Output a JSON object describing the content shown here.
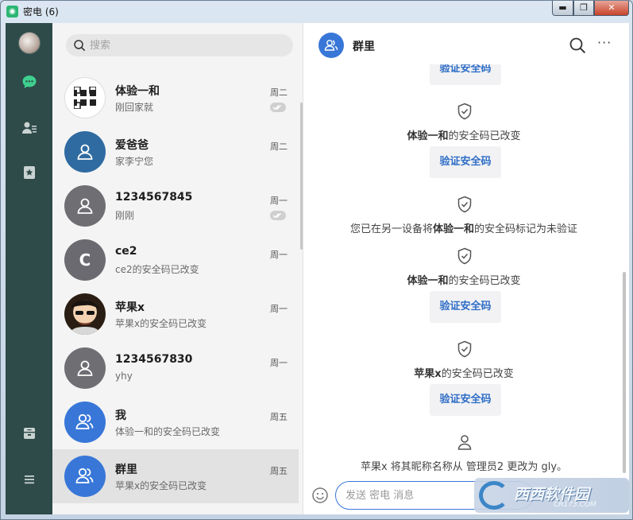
{
  "window": {
    "app_icon": "chat-bubble-icon",
    "title": "密电 (6)",
    "controls": {
      "minimize": "▬",
      "maximize": "❐",
      "close": "✕"
    }
  },
  "rail": {
    "items": [
      "user-avatar",
      "chat-icon",
      "contacts-icon",
      "favorites-icon",
      "archive-icon",
      "menu-icon"
    ]
  },
  "search": {
    "placeholder": "搜索"
  },
  "conversations": [
    {
      "name": "体验一和",
      "preview": "刚回家就",
      "time": "周二",
      "avatar": "qr-avatar",
      "read": true,
      "selected": false
    },
    {
      "name": "爱爸爸",
      "preview": "家李宁您",
      "time": "周二",
      "avatar": "person-dark-blue",
      "read": false,
      "selected": false
    },
    {
      "name": "1234567845",
      "preview": "刚刚",
      "time": "周一",
      "avatar": "person-gray",
      "read": true,
      "selected": false
    },
    {
      "name": "ce2",
      "preview": "ce2的安全码已改变",
      "time": "周一",
      "avatar": "letter-C",
      "initial": "C",
      "read": false,
      "selected": false
    },
    {
      "name": "苹果x",
      "preview": "苹果x的安全码已改变",
      "time": "周一",
      "avatar": "cartoon-avatar",
      "read": false,
      "selected": false
    },
    {
      "name": "1234567830",
      "preview": "yhy",
      "time": "周一",
      "avatar": "person-gray",
      "read": false,
      "selected": false
    },
    {
      "name": "我",
      "preview": "体验一和的安全码已改变",
      "time": "周五",
      "avatar": "group-blue",
      "read": false,
      "selected": false
    },
    {
      "name": "群里",
      "preview": "苹果x的安全码已改变",
      "time": "周五",
      "avatar": "group-blue",
      "read": false,
      "selected": true
    }
  ],
  "chat": {
    "title": "群里",
    "verify_label": "验证安全码",
    "messages": [
      {
        "kind": "verify"
      },
      {
        "kind": "notice",
        "bold": "体验一和",
        "rest": "的安全码已改变",
        "icon": "shield-check-icon"
      },
      {
        "kind": "verify"
      },
      {
        "kind": "notice",
        "pre": "您已在另一设备将",
        "bold": "体验一和",
        "rest": "的安全码标记为未验证",
        "icon": "shield-check-icon"
      },
      {
        "kind": "notice",
        "bold": "体验一和",
        "rest": "的安全码已改变",
        "icon": "shield-check-icon"
      },
      {
        "kind": "verify"
      },
      {
        "kind": "notice",
        "bold": "苹果x",
        "rest": "的安全码已改变",
        "icon": "shield-check-icon"
      },
      {
        "kind": "verify"
      },
      {
        "kind": "nickname",
        "text": "苹果x 将其昵称名称从 管理员2 更改为 gly。",
        "icon": "person-outline-icon"
      }
    ],
    "composer_placeholder": "发送 密电 消息"
  },
  "watermark": {
    "text": "西西软件园",
    "sub": "CR173.COM"
  },
  "colors": {
    "rail": "#2e4a49",
    "accent": "#3877d8",
    "verify_text": "#2f6ec7",
    "list_bg": "#f4f4f4"
  }
}
